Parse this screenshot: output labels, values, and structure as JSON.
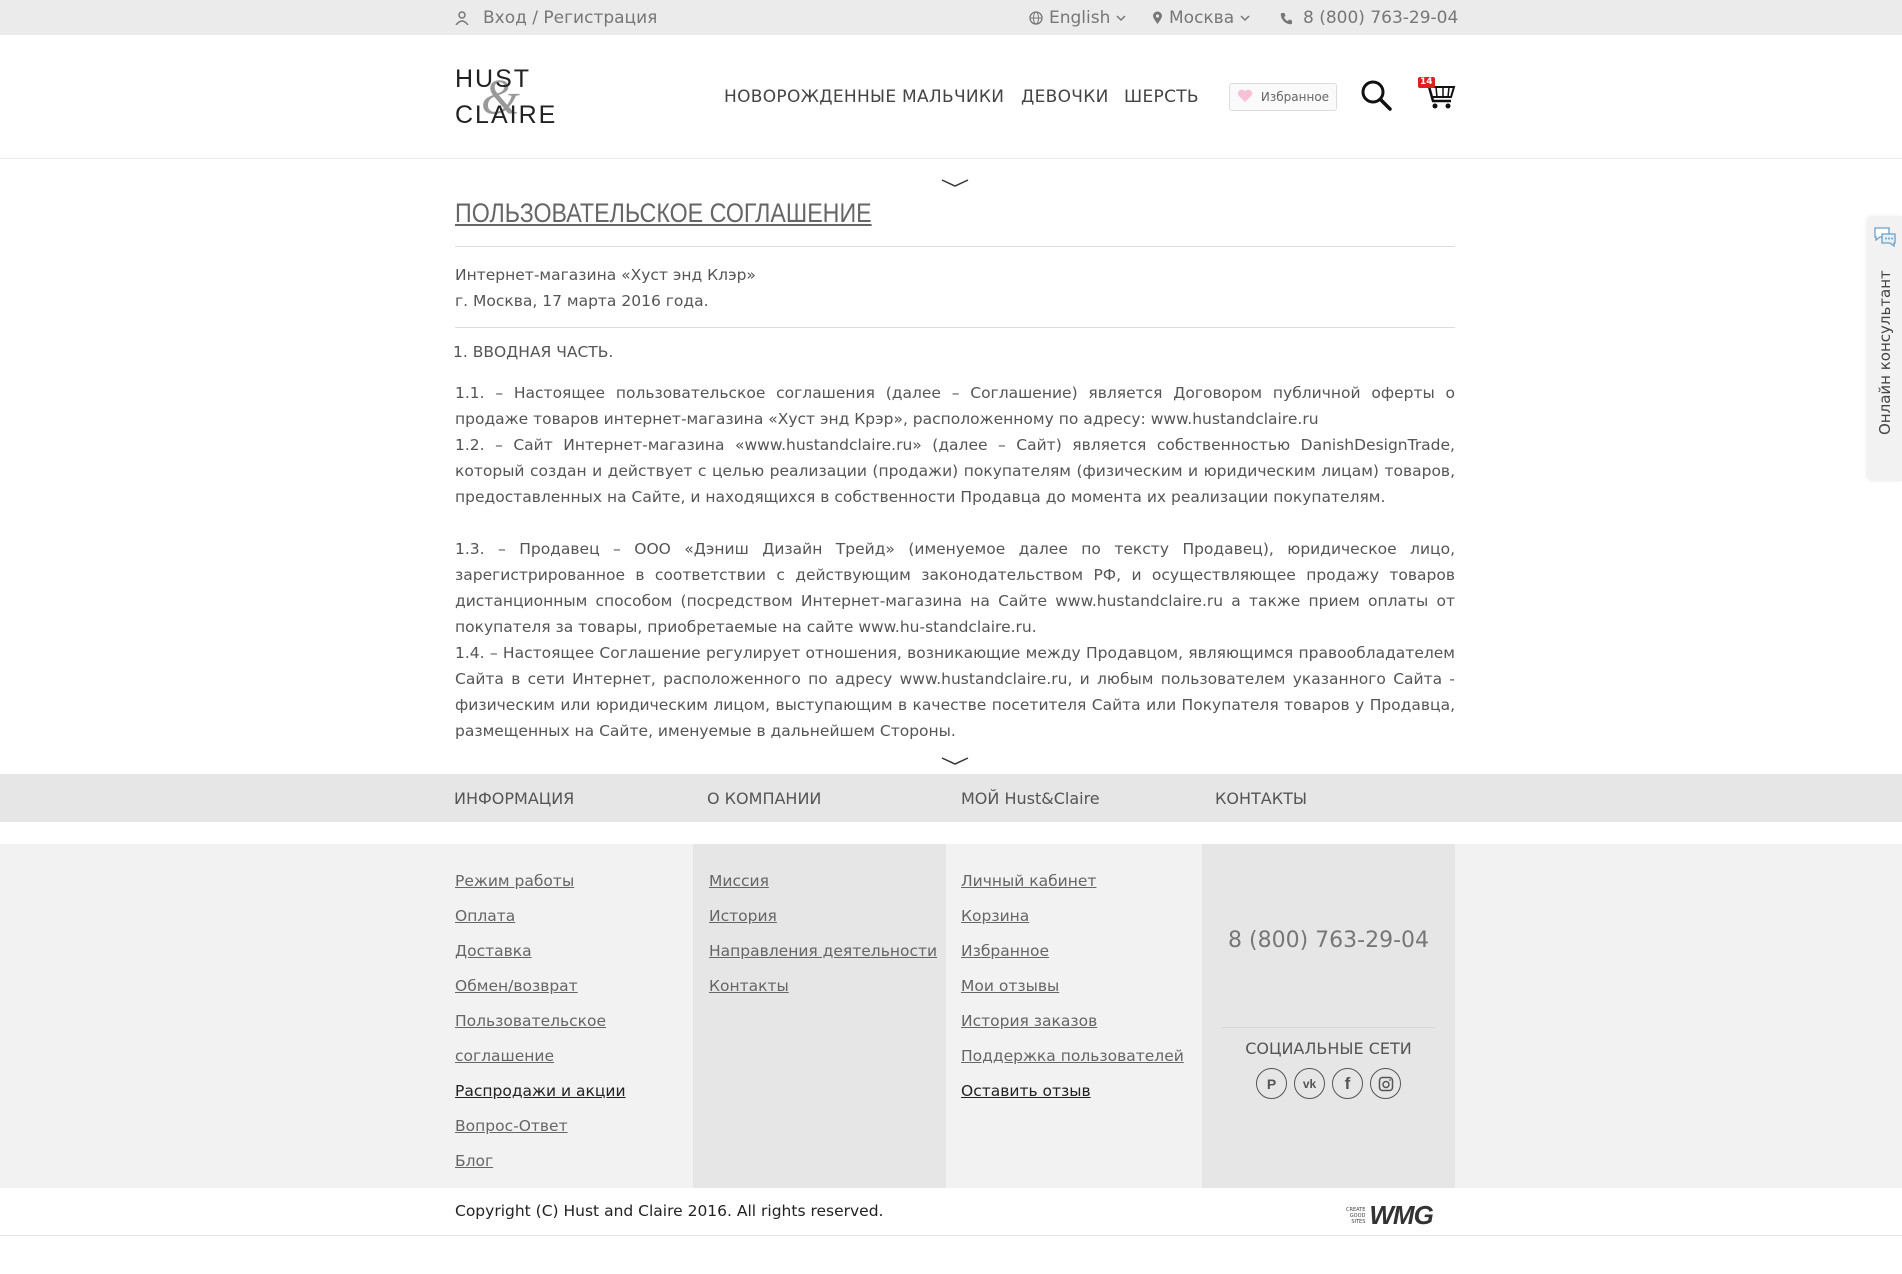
{
  "topbar": {
    "login": "Вход / Регистрация",
    "language": "English",
    "city": "Москва",
    "phone": "8 (800) 763-29-04"
  },
  "header": {
    "logo_line1": "HUST",
    "logo_amp": "&",
    "logo_line2": "CLAIRE",
    "nav": [
      "НОВОРОЖДЕННЫЕ",
      "МАЛЬЧИКИ",
      "ДЕВОЧКИ",
      "ШЕРСТЬ"
    ],
    "favorites_label": "Избранное",
    "cart_count": "14"
  },
  "page": {
    "title": "ПОЛЬЗОВАТЕЛЬСКОЕ СОГЛАШЕНИЕ",
    "meta_line1": "Интернет-магазина «Хуст энд Клэр»",
    "meta_line2": "г. Москва, 17 марта 2016 года.",
    "section": "1. ВВОДНАЯ ЧАСТЬ.",
    "p1": "1.1. – Настоящее пользовательское соглашения (далее – Соглашение) является Договором публичной оферты о продаже товаров интернет-магазина «Хуст энд Крэр», расположенному по адресу: www.hustandclaire.ru",
    "p2": "1.2. – Сайт Интернет-магазина «www.hustandclaire.ru» (далее – Сайт) является собственностью DanishDesignTrade, который создан и действует с целью реализации (продажи) покупателям (физическим и юридическим лицам) товаров, предоставленных на Сайте, и находящихся в собственности Продавца до момента их реализации покупателям.",
    "p3": "1.3. – Продавец – ООО «Дэниш Дизайн Трейд» (именуемое далее по тексту Продавец), юридическое лицо, зарегистрированное в соответствии с действующим законодательством РФ, и осуществляющее продажу товаров дистанционным способом (посредством Интернет-магазина на Сайте www.hustandclaire.ru а также прием оплаты от покупателя за товары, приобретаемые на сайте www.hu-standclaire.ru.",
    "p4": "1.4. – Настоящее Соглашение регулирует отношения, возникающие между Продавцом, являющимся правообладателем Сайта в сети Интернет, расположенного по адресу www.hustandclaire.ru, и любым пользователем указанного Сайта - физическим или юридическим лицом, выступающим в качестве посетителя Сайта или Покупателя товаров у Продавца, размещенных на Сайте, именуемые в дальнейшем Стороны."
  },
  "footer_nav": {
    "info": "ИНФОРМАЦИЯ",
    "company": "О КОМПАНИИ",
    "my": "МОЙ Hust&Claire",
    "contacts": "КОНТАКТЫ"
  },
  "footer": {
    "info_links": [
      "Режим работы",
      "Оплата",
      "Доставка",
      "Обмен/возврат",
      "Пользовательское",
      "соглашение",
      "Распродажи и акции",
      "Вопрос-Ответ",
      "Блог"
    ],
    "company_links": [
      "Миссия",
      "История",
      "Направления деятельности",
      "Контакты"
    ],
    "my_links": [
      "Личный кабинет",
      "Корзина",
      "Избранное",
      "Мои отзывы",
      "История заказов",
      "Поддержка пользователей",
      "Оставить отзыв"
    ],
    "phone": "8 (800) 763-29-04",
    "social_heading": "СОЦИАЛЬНЫЕ СЕТИ",
    "social_icons": [
      "pinterest-icon",
      "vk-icon",
      "facebook-icon",
      "instagram-icon"
    ],
    "copyright": "Copyright (C) Hust and Claire 2016. All rights reserved.",
    "wmg_small_1": "CREATE",
    "wmg_small_2": "GOOD",
    "wmg_small_3": "SITES",
    "wmg_big": "WMG"
  },
  "consultant": {
    "label": "Онлайн консультант"
  },
  "colors": {
    "badge": "#e02020",
    "topbar_bg": "#ebebeb",
    "footer_bg": "#f2f2f2"
  }
}
